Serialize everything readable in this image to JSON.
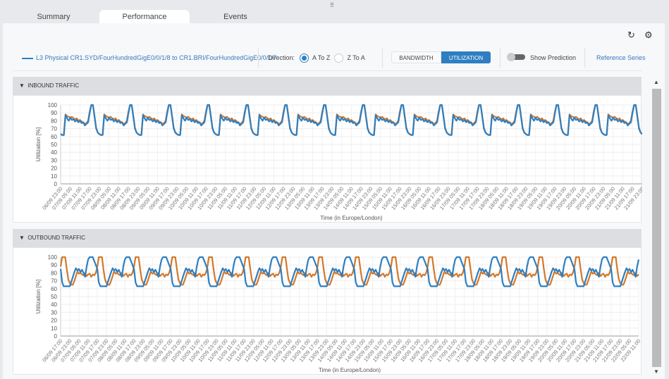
{
  "tabs": [
    {
      "label": "Summary",
      "active": false
    },
    {
      "label": "Performance",
      "active": true
    },
    {
      "label": "Events",
      "active": false
    }
  ],
  "toolbar": {
    "series_link": "L3 Physical CR1.SYD/FourHundredGigE0/0/1/8 to CR1.BRI/FourHundredGigE0/0/1/7",
    "direction_label": "Direction:",
    "direction_options": [
      "A To Z",
      "Z To A"
    ],
    "direction_selected": "A To Z",
    "mode_options": [
      "BANDWIDTH",
      "UTILIZATION"
    ],
    "mode_selected": "UTILIZATION",
    "prediction_label": "Show Prediction",
    "prediction_on": false,
    "reference_label": "Reference Series",
    "icons": [
      "refresh-icon",
      "gear-icon"
    ]
  },
  "colors": {
    "accent": "#2e7fc1",
    "series_a": "#2e7fc1",
    "series_b": "#d2782a"
  },
  "sections": [
    {
      "title": "INBOUND TRAFFIC"
    },
    {
      "title": "OUTBOUND TRAFFIC"
    }
  ],
  "chart_data": [
    {
      "type": "line",
      "title": "",
      "xlabel": "Time (in Europe/London)",
      "ylabel": "Utilization [%]",
      "ylim": [
        0,
        100
      ],
      "yticks": [
        "0",
        "10",
        "20",
        "30",
        "40",
        "50",
        "60",
        "70",
        "80",
        "90",
        "100"
      ],
      "grid": true,
      "x_range": [
        "06/09 23:00",
        "21/09 23:00"
      ],
      "x_ticks": [
        "06/09 23:00",
        "07/09 05:00",
        "07/09 11:00",
        "07/09 17:00",
        "07/09 23:00",
        "08/09 05:00",
        "08/09 11:00",
        "08/09 17:00",
        "08/09 23:00",
        "09/09 05:00",
        "09/09 11:00",
        "09/09 17:00",
        "09/09 23:00",
        "10/09 05:00",
        "10/09 11:00",
        "10/09 17:00",
        "10/09 23:00",
        "11/09 05:00",
        "11/09 11:00",
        "11/09 17:00",
        "11/09 23:00",
        "12/09 05:00",
        "12/09 11:00",
        "12/09 17:00",
        "12/09 23:00",
        "13/09 05:00",
        "13/09 11:00",
        "13/09 17:00",
        "13/09 23:00",
        "14/09 05:00",
        "14/09 11:00",
        "14/09 17:00",
        "14/09 23:00",
        "15/09 05:00",
        "15/09 11:00",
        "15/09 17:00",
        "15/09 23:00",
        "16/09 05:00",
        "16/09 11:00",
        "16/09 17:00",
        "16/09 23:00",
        "17/09 05:00",
        "17/09 11:00",
        "17/09 17:00",
        "17/09 23:00",
        "18/09 05:00",
        "18/09 11:00",
        "18/09 17:00",
        "18/09 23:00",
        "19/09 05:00",
        "19/09 11:00",
        "19/09 17:00",
        "19/09 23:00",
        "20/09 05:00",
        "20/09 11:00",
        "20/09 17:00",
        "20/09 23:00",
        "21/09 05:00",
        "21/09 11:00",
        "21/09 17:00",
        "21/09 23:00"
      ],
      "series": [
        {
          "color": "#d2782a",
          "hourly_profile": [
            62,
            62,
            88,
            86,
            85,
            84,
            85,
            83,
            82,
            83,
            80,
            81,
            79,
            78,
            76,
            77,
            80,
            92,
            100,
            100,
            86,
            71,
            65,
            63
          ]
        },
        {
          "color": "#2e7fc1",
          "hourly_profile": [
            62,
            62,
            87,
            83,
            80,
            84,
            81,
            82,
            79,
            81,
            78,
            80,
            77,
            78,
            74,
            76,
            78,
            90,
            100,
            100,
            85,
            70,
            65,
            63
          ]
        }
      ]
    },
    {
      "type": "line",
      "title": "",
      "xlabel": "Time (in Europe/London)",
      "ylabel": "Utilization [%]",
      "ylim": [
        0,
        100
      ],
      "yticks": [
        "0",
        "10",
        "20",
        "30",
        "40",
        "50",
        "60",
        "70",
        "80",
        "90",
        "100"
      ],
      "grid": true,
      "x_range": [
        "06/09 17:00",
        "22/09 11:00"
      ],
      "x_ticks": [
        "06/09 17:00",
        "06/09 23:00",
        "07/09 05:00",
        "07/09 11:00",
        "07/09 17:00",
        "07/09 23:00",
        "08/09 05:00",
        "08/09 11:00",
        "08/09 17:00",
        "08/09 23:00",
        "09/09 05:00",
        "09/09 11:00",
        "09/09 17:00",
        "09/09 23:00",
        "10/09 05:00",
        "10/09 11:00",
        "10/09 17:00",
        "10/09 23:00",
        "11/09 05:00",
        "11/09 11:00",
        "11/09 17:00",
        "11/09 23:00",
        "12/09 05:00",
        "12/09 11:00",
        "12/09 17:00",
        "12/09 23:00",
        "13/09 05:00",
        "13/09 11:00",
        "13/09 17:00",
        "13/09 23:00",
        "14/09 05:00",
        "14/09 11:00",
        "14/09 17:00",
        "14/09 23:00",
        "15/09 05:00",
        "15/09 11:00",
        "15/09 17:00",
        "15/09 23:00",
        "16/09 05:00",
        "16/09 11:00",
        "16/09 17:00",
        "16/09 23:00",
        "17/09 05:00",
        "17/09 11:00",
        "17/09 17:00",
        "17/09 23:00",
        "18/09 05:00",
        "18/09 11:00",
        "18/09 17:00",
        "18/09 23:00",
        "19/09 05:00",
        "19/09 11:00",
        "19/09 17:00",
        "19/09 23:00",
        "20/09 05:00",
        "20/09 11:00",
        "20/09 17:00",
        "20/09 23:00",
        "21/09 05:00",
        "21/09 11:00",
        "21/09 17:00",
        "21/09 23:00",
        "22/09 05:00",
        "22/09 11:00"
      ],
      "series": [
        {
          "color": "#d2782a",
          "hourly_profile": [
            65,
            65,
            70,
            76,
            82,
            79,
            80,
            78,
            77,
            80,
            76,
            78,
            79,
            75,
            78,
            77,
            80,
            88,
            100,
            100,
            100,
            85,
            72,
            67
          ]
        },
        {
          "color": "#2e7fc1",
          "hourly_profile": [
            69,
            75,
            81,
            86,
            83,
            85,
            81,
            84,
            80,
            75,
            88,
            97,
            100,
            100,
            100,
            95,
            90,
            85,
            68,
            63,
            63,
            63,
            63,
            63
          ]
        }
      ]
    }
  ]
}
